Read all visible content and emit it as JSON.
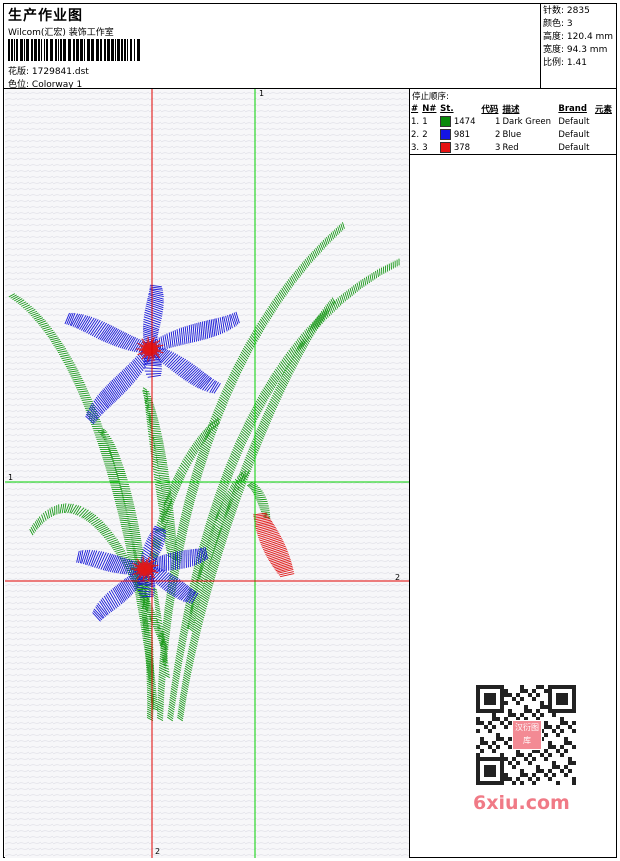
{
  "header": {
    "title": "生产作业图",
    "studio": "Wilcom(汇宏) 装饰工作室",
    "design_label": "花版:",
    "design_file": "1729841.dst",
    "colorway_label": "色位:",
    "colorway": "Colorway 1"
  },
  "stats": [
    {
      "label": "针数:",
      "value": "2835"
    },
    {
      "label": "颜色:",
      "value": "3"
    },
    {
      "label": "高度:",
      "value": "120.4 mm"
    },
    {
      "label": "宽度:",
      "value": "94.3 mm"
    },
    {
      "label": "比例:",
      "value": "1.41"
    }
  ],
  "stop_sequence": {
    "title": "停止顺序:",
    "columns": [
      "#",
      "N#",
      "St.",
      "代码",
      "描述",
      "Brand",
      "元素"
    ],
    "rows": [
      {
        "idx": "1.",
        "n": "1",
        "st": "1474",
        "code": "1",
        "desc": "Dark Green",
        "brand": "Default",
        "color": "#0a8a0a"
      },
      {
        "idx": "2.",
        "n": "2",
        "st": "981",
        "code": "2",
        "desc": "Blue",
        "brand": "Default",
        "color": "#1414e6"
      },
      {
        "idx": "3.",
        "n": "3",
        "st": "378",
        "code": "3",
        "desc": "Red",
        "brand": "Default",
        "color": "#e61414"
      }
    ]
  },
  "guides": {
    "green_label_top": "1",
    "green_label_left": "1",
    "red_label_right": "2",
    "red_label_bottom": "2"
  },
  "watermark": {
    "qr_caption": "汉衍图库",
    "site": "6xiu.com"
  },
  "colors": {
    "green": "#1a9a1a",
    "blue": "#1818d8",
    "red": "#e01818",
    "guide_green": "#00d000",
    "guide_red": "#e00000"
  }
}
